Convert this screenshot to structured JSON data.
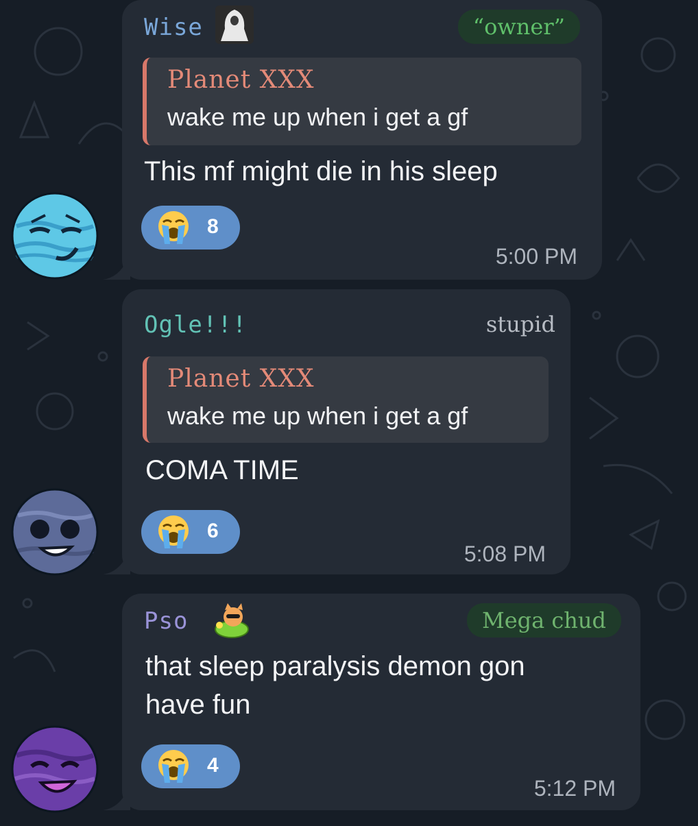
{
  "colors": {
    "background": "#161d26",
    "bubble": "#242b35",
    "quote_bg": "#353a42",
    "quote_accent": "#d8786a",
    "reaction_bg": "#5f8fc9",
    "role_pill_green": "#1f3b2a"
  },
  "messages": [
    {
      "sender": "Wise",
      "sender_color": "#7aa7d9",
      "sender_sticker": "hooded-figure-icon",
      "role": "“owner”",
      "role_color": "#5fbf6a",
      "reply_to": {
        "name": "Planet XXX",
        "text": "wake me up when i get a gf"
      },
      "text": "This mf might die in his sleep",
      "reaction": {
        "emoji": "loudly-crying-face-icon",
        "count": "8"
      },
      "time": "5:00 PM",
      "avatar": "blue-planet-smirk-avatar"
    },
    {
      "sender": "Ogle!!!",
      "sender_color": "#62c2b5",
      "role": "stupid",
      "role_color": "#b7bcc4",
      "reply_to": {
        "name": "Planet XXX",
        "text": "wake me up when i get a gf"
      },
      "text": "COMA TIME",
      "reaction": {
        "emoji": "loudly-crying-face-icon",
        "count": "6"
      },
      "time": "5:08 PM",
      "avatar": "grey-blue-planet-grin-avatar"
    },
    {
      "sender": "Pso",
      "sender_color": "#9a93d8",
      "sender_sticker": "cat-in-float-icon",
      "role": "Mega chud",
      "role_color": "#6fb36e",
      "text_line1": "that sleep paralysis demon gon",
      "text_line2": "have fun",
      "reaction": {
        "emoji": "loudly-crying-face-icon",
        "count": "4"
      },
      "time": "5:12 PM",
      "avatar": "purple-planet-laugh-avatar"
    }
  ]
}
